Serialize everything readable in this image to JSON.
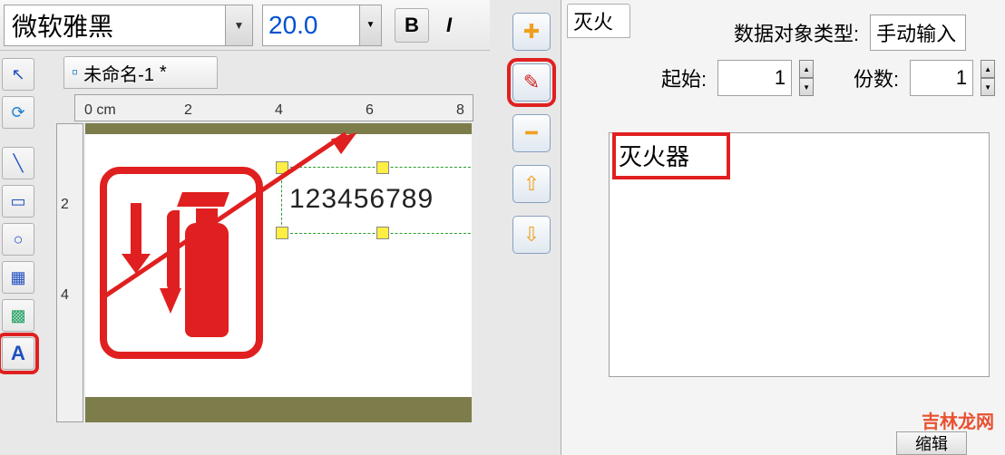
{
  "toolbar": {
    "font_name": "微软雅黑",
    "font_size": "20.0",
    "bold_label": "B",
    "italic_label": "I"
  },
  "document": {
    "tab_title": "未命名-1",
    "tab_modified": "*"
  },
  "ruler": {
    "unit_label": "0 cm",
    "ticks_h": [
      "0 cm",
      "2",
      "4",
      "6",
      "8"
    ],
    "ticks_v": [
      "2",
      "4"
    ]
  },
  "canvas": {
    "number_text": "123456789"
  },
  "icons": {
    "pointer": "↖",
    "lasso": "⟳",
    "line": "╲",
    "rounded_rect": "▭",
    "circle": "○",
    "barcode": "▦",
    "image": "▩",
    "text": "A",
    "doc": "▫",
    "plus": "✚",
    "edit": "✎",
    "minus": "━",
    "up": "⇧",
    "down": "⇩"
  },
  "right_panel": {
    "partial_tab": "灭火",
    "data_type_label": "数据对象类型:",
    "data_type_value": "手动输入",
    "start_label": "起始:",
    "start_value": "1",
    "copies_label": "份数:",
    "copies_value": "1",
    "textarea_value": "灭火器",
    "bottom_button": "缩辑"
  },
  "watermark": "吉林龙网"
}
